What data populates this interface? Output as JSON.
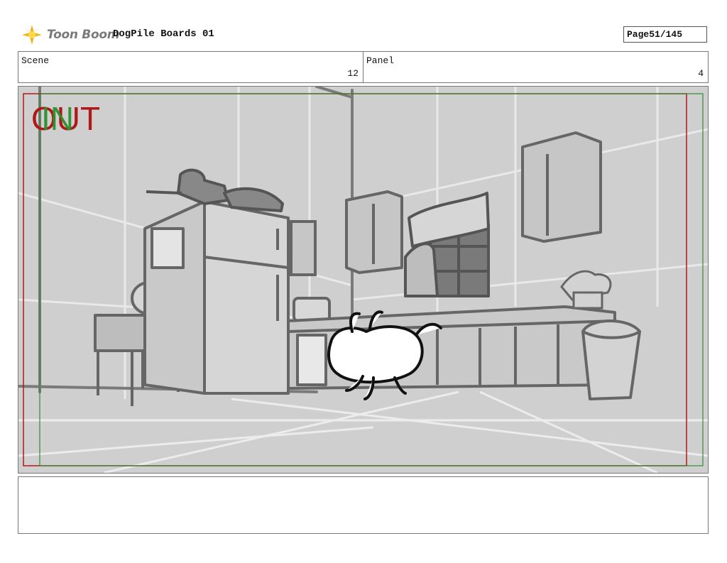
{
  "header": {
    "logo_text": "Toon Boom",
    "doc_title": "DogPile Boards 01",
    "page_label": "Page",
    "page_value": "51/145"
  },
  "info": {
    "scene_label": "Scene",
    "scene_value": "12",
    "panel_label": "Panel",
    "panel_value": "4"
  },
  "panel": {
    "out_label": "OUT",
    "in_label": "IN",
    "safe_frame_color": "#b01818",
    "camera_frame_color": "#2e8f2e"
  },
  "notes": {
    "text": ""
  }
}
